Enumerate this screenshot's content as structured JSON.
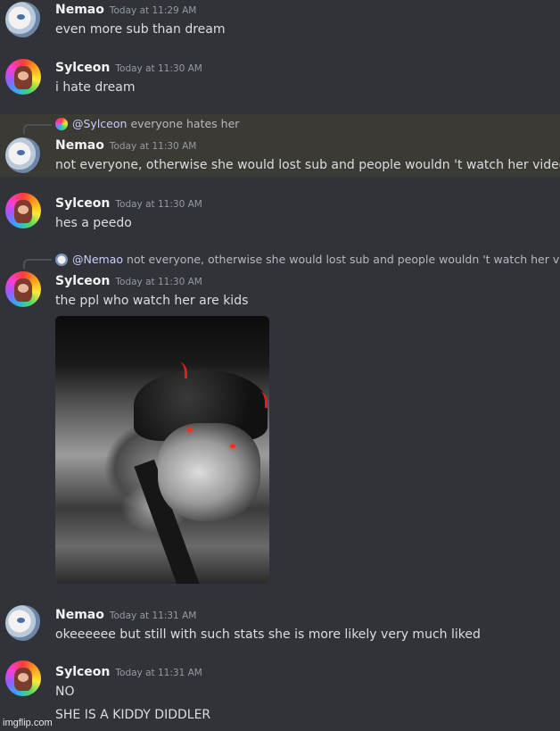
{
  "messages": [
    {
      "author": "Nemao",
      "time": "Today at 11:29 AM",
      "lines": [
        "even more sub than dream"
      ]
    },
    {
      "author": "Sylceon",
      "time": "Today at 11:30 AM",
      "lines": [
        "i hate dream"
      ]
    },
    {
      "author": "Nemao",
      "time": "Today at 11:30 AM",
      "lines": [
        "not everyone, otherwise she would lost sub and people wouldn 't watch her video"
      ],
      "reply": {
        "mention": "@Sylceon",
        "text": "everyone hates her"
      }
    },
    {
      "author": "Sylceon",
      "time": "Today at 11:30 AM",
      "lines": [
        "hes a peedo"
      ]
    },
    {
      "author": "Sylceon",
      "time": "Today at 11:30 AM",
      "lines": [
        "the ppl who watch her are kids"
      ],
      "reply": {
        "mention": "@Nemao",
        "text": "not everyone, otherwise she would lost sub and people wouldn 't watch her video"
      }
    },
    {
      "author": "Nemao",
      "time": "Today at 11:31 AM",
      "lines": [
        "okeeeeee but still with such stats she is more likely very much liked"
      ]
    },
    {
      "author": "Sylceon",
      "time": "Today at 11:31 AM",
      "lines": [
        "NO",
        "SHE IS A KIDDY DIDDLER"
      ]
    }
  ],
  "attachment": {
    "alt": "black and white selfie with red devil horns and glowing eyes",
    "accent": "#e0201c"
  },
  "watermark": "imgflip.com",
  "colors": {
    "background": "#313338",
    "highlight": "#3b3a34",
    "mention": "#c9cdfb"
  },
  "icons": {
    "nemao_avatar": "anime-character-avatar",
    "sylceon_avatar": "rainbow-character-avatar"
  }
}
